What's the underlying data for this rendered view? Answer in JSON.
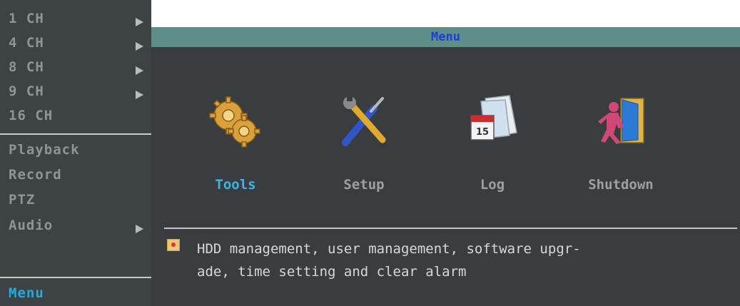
{
  "sidebar": {
    "items": [
      {
        "label": "1 CH",
        "submenu": true
      },
      {
        "label": "4 CH",
        "submenu": true
      },
      {
        "label": "8 CH",
        "submenu": true
      },
      {
        "label": "9 CH",
        "submenu": true
      },
      {
        "label": "16 CH",
        "submenu": false
      },
      {
        "label": "Playback",
        "submenu": false
      },
      {
        "label": "Record",
        "submenu": false
      },
      {
        "label": "PTZ",
        "submenu": false
      },
      {
        "label": "Audio",
        "submenu": true
      },
      {
        "label": "Menu",
        "submenu": false
      }
    ]
  },
  "window": {
    "title": "Menu"
  },
  "tiles": [
    {
      "label": "Tools",
      "icon": "gears-icon",
      "selected": true
    },
    {
      "label": "Setup",
      "icon": "wrench-screwdriver-icon",
      "selected": false
    },
    {
      "label": "Log",
      "icon": "calendar-log-icon",
      "selected": false
    },
    {
      "label": "Shutdown",
      "icon": "exit-door-icon",
      "selected": false
    }
  ],
  "info": {
    "icon": "bullet-icon",
    "line1": "HDD management, user management, software upgr-",
    "line2": "ade, time setting and clear alarm"
  }
}
